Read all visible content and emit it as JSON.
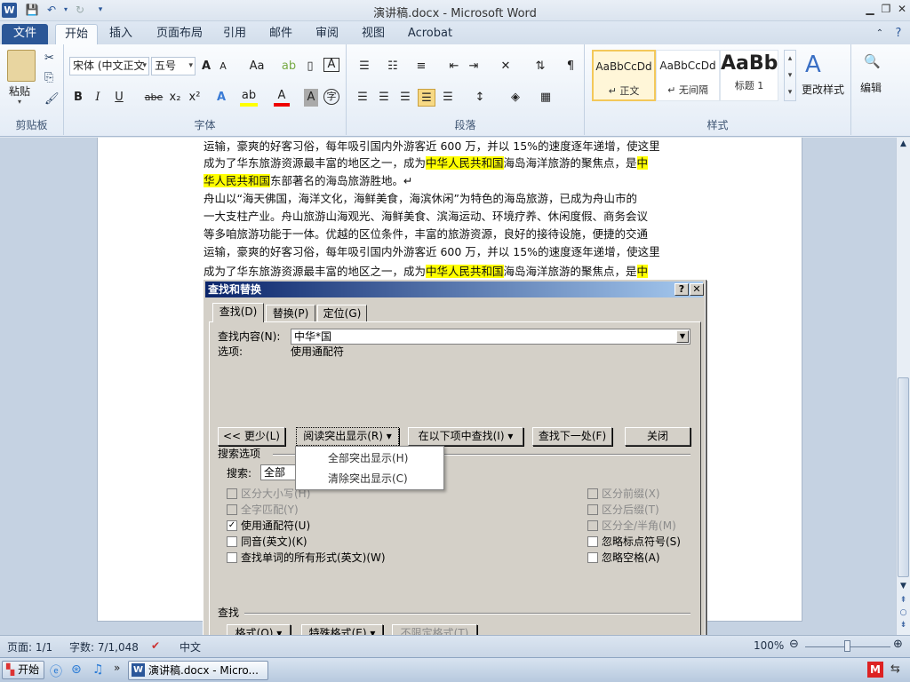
{
  "window": {
    "title": "演讲稿.docx - Microsoft Word"
  },
  "tabs": [
    "文件",
    "开始",
    "插入",
    "页面布局",
    "引用",
    "邮件",
    "审阅",
    "视图",
    "Acrobat"
  ],
  "ribbon": {
    "clipboard": {
      "label": "剪贴板",
      "paste": "粘贴"
    },
    "font": {
      "label": "字体",
      "name": "宋体 (中文正文",
      "size": "五号",
      "grow": "A",
      "shrink": "A",
      "case": "Aa",
      "bold": "B",
      "italic": "I",
      "underline": "U",
      "strike": "abe",
      "sub": "x₂",
      "sup": "x²"
    },
    "paragraph": {
      "label": "段落"
    },
    "styles": {
      "label": "样式",
      "items": [
        {
          "preview": "AaBbCcDd",
          "name": "↵ 正文"
        },
        {
          "preview": "AaBbCcDd",
          "name": "↵ 无间隔"
        },
        {
          "preview": "AaBb",
          "name": "标题 1"
        }
      ],
      "change": "更改样式"
    },
    "editing": {
      "label": "编辑"
    }
  },
  "document": {
    "lines": [
      {
        "parts": [
          {
            "t": "运输，豪爽的好客习俗，每年吸引国内外游客近 600 万，并以 15%的速度逐年递增，使这里",
            "h": false
          }
        ]
      },
      {
        "parts": [
          {
            "t": "成为了华东旅游资源最丰富的地区之一，成为",
            "h": false
          },
          {
            "t": "中华人民共和国",
            "h": true
          },
          {
            "t": "海岛海洋旅游的聚焦点，是",
            "h": false
          },
          {
            "t": "中",
            "h": true
          }
        ]
      },
      {
        "parts": [
          {
            "t": "华人民共和国",
            "h": true
          },
          {
            "t": "东部著名的海岛旅游胜地。↵",
            "h": false
          }
        ]
      },
      {
        "parts": [
          {
            "t": "舟山以“海天佛国，海洋文化，海鲜美食，海滨休闲”为特色的海岛旅游，已成为舟山市的",
            "h": false
          }
        ]
      },
      {
        "parts": [
          {
            "t": "一大支柱产业。舟山旅游山海观光、海鲜美食、滨海运动、环境疗养、休闲度假、商务会议",
            "h": false
          }
        ]
      },
      {
        "parts": [
          {
            "t": "等多咱旅游功能于一体。优越的区位条件，丰富的旅游资源，良好的接待设施，便捷的交通",
            "h": false
          }
        ]
      },
      {
        "parts": [
          {
            "t": "运输，豪爽的好客习俗，每年吸引国内外游客近 600 万，并以 15%的速度逐年递增，使这里",
            "h": false
          }
        ]
      },
      {
        "parts": [
          {
            "t": "成为了华东旅游资源最丰富的地区之一，成为",
            "h": false
          },
          {
            "t": "中华人民共和国",
            "h": true
          },
          {
            "t": "海岛海洋旅游的聚焦点，是",
            "h": false
          },
          {
            "t": "中",
            "h": true
          }
        ]
      }
    ]
  },
  "dialog": {
    "title": "查找和替换",
    "help": "?",
    "close": "✕",
    "tabs": [
      "查找(D)",
      "替换(P)",
      "定位(G)"
    ],
    "find_label": "查找内容(N):",
    "find_value": "中华*国",
    "options_label": "选项:",
    "options_value": "使用通配符",
    "btn_less": "<< 更少(L)",
    "btn_reading": "阅读突出显示(R) ▾",
    "btn_findin": "在以下项中查找(I) ▾",
    "btn_next": "查找下一处(F)",
    "btn_close": "关闭",
    "search_options": "搜索选项",
    "search_label": "搜索:",
    "search_value": "全部",
    "checks_left": [
      {
        "label": "区分大小写(H)",
        "checked": false,
        "disabled": true
      },
      {
        "label": "全字匹配(Y)",
        "checked": false,
        "disabled": true
      },
      {
        "label": "使用通配符(U)",
        "checked": true,
        "disabled": false
      },
      {
        "label": "同音(英文)(K)",
        "checked": false,
        "disabled": false
      },
      {
        "label": "查找单词的所有形式(英文)(W)",
        "checked": false,
        "disabled": false
      }
    ],
    "checks_right": [
      {
        "label": "区分前缀(X)",
        "checked": false,
        "disabled": true
      },
      {
        "label": "区分后缀(T)",
        "checked": false,
        "disabled": true
      },
      {
        "label": "区分全/半角(M)",
        "checked": false,
        "disabled": true
      },
      {
        "label": "忽略标点符号(S)",
        "checked": false,
        "disabled": false
      },
      {
        "label": "忽略空格(A)",
        "checked": false,
        "disabled": false
      }
    ],
    "find_section": "查找",
    "btn_format": "格式(O) ▾",
    "btn_special": "特殊格式(E) ▾",
    "btn_noformat": "不限定格式(T)",
    "menu": [
      "全部突出显示(H)",
      "清除突出显示(C)"
    ]
  },
  "status": {
    "page": "页面: 1/1",
    "words": "字数: 7/1,048",
    "lang": "中文",
    "zoom": "100%"
  },
  "taskbar": {
    "start": "开始",
    "task": "演讲稿.docx - Micro..."
  }
}
